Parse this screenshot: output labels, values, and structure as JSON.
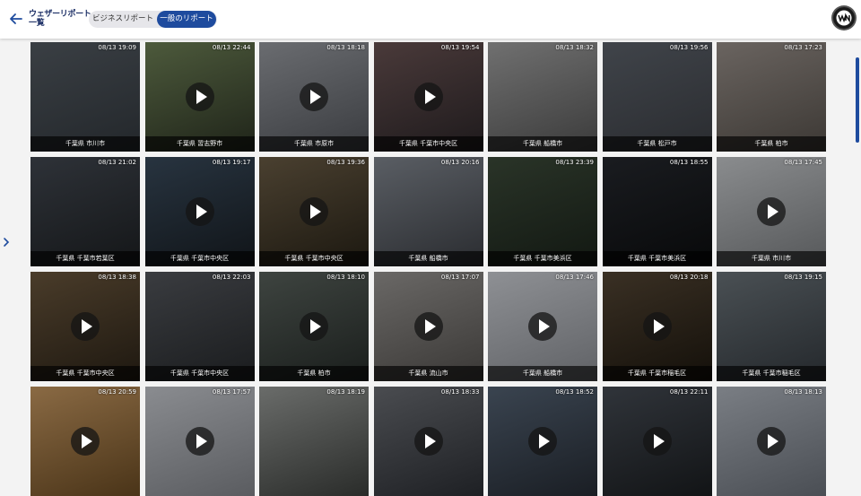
{
  "header": {
    "title_line1": "ウェザーリポート",
    "title_line2": "一覧",
    "tabs": [
      {
        "label": "ビジネスリポート",
        "active": false
      },
      {
        "label": "一般のリポート",
        "active": true
      }
    ]
  },
  "colors": {
    "accent": "#1e4b9e"
  },
  "reports": [
    {
      "time": "08/13 19:09",
      "location": "千葉県 市川市",
      "video": false,
      "bg": [
        "#3a3f44",
        "#23272b"
      ]
    },
    {
      "time": "08/13 22:44",
      "location": "千葉県 習志野市",
      "video": true,
      "bg": [
        "#4d5a3c",
        "#1f2419"
      ]
    },
    {
      "time": "08/13 18:18",
      "location": "千葉県 市原市",
      "video": true,
      "bg": [
        "#6a6c70",
        "#3a3c40"
      ]
    },
    {
      "time": "08/13 19:54",
      "location": "千葉県 千葉市中央区",
      "video": true,
      "bg": [
        "#4a3a3a",
        "#1e1a1c"
      ]
    },
    {
      "time": "08/13 18:32",
      "location": "千葉県 船橋市",
      "video": false,
      "bg": [
        "#707070",
        "#3b3b3b"
      ]
    },
    {
      "time": "08/13 19:56",
      "location": "千葉県 松戸市",
      "video": false,
      "bg": [
        "#40444a",
        "#2a2c30"
      ]
    },
    {
      "time": "08/13 17:23",
      "location": "千葉県 柏市",
      "video": false,
      "bg": [
        "#6a6460",
        "#3c3834"
      ]
    },
    {
      "time": "08/13 21:02",
      "location": "千葉県 千葉市若葉区",
      "video": false,
      "bg": [
        "#2e3238",
        "#141618"
      ]
    },
    {
      "time": "08/13 19:17",
      "location": "千葉県 千葉市中央区",
      "video": true,
      "bg": [
        "#283440",
        "#101418"
      ]
    },
    {
      "time": "08/13 19:36",
      "location": "千葉県 千葉市中央区",
      "video": true,
      "bg": [
        "#4a4030",
        "#1c1810"
      ]
    },
    {
      "time": "08/13 20:16",
      "location": "千葉県 船橋市",
      "video": false,
      "bg": [
        "#5a5e64",
        "#2a2c30"
      ]
    },
    {
      "time": "08/13 23:39",
      "location": "千葉県 千葉市美浜区",
      "video": false,
      "bg": [
        "#2a3428",
        "#121812"
      ]
    },
    {
      "time": "08/13 18:55",
      "location": "千葉県 千葉市美浜区",
      "video": false,
      "bg": [
        "#1a1c20",
        "#08090a"
      ]
    },
    {
      "time": "08/13 17:45",
      "location": "千葉県 市川市",
      "video": true,
      "bg": [
        "#8a8c8e",
        "#56585a"
      ]
    },
    {
      "time": "08/13 18:38",
      "location": "千葉県 千葉市中央区",
      "video": true,
      "bg": [
        "#4a3c2a",
        "#1e1810"
      ]
    },
    {
      "time": "08/13 22:03",
      "location": "千葉県 千葉市中央区",
      "video": false,
      "bg": [
        "#3a3c40",
        "#1a1c1e"
      ]
    },
    {
      "time": "08/13 18:10",
      "location": "千葉県 柏市",
      "video": true,
      "bg": [
        "#3e4440",
        "#1a1e1c"
      ]
    },
    {
      "time": "08/13 17:07",
      "location": "千葉県 流山市",
      "video": true,
      "bg": [
        "#6a6866",
        "#3a3836"
      ]
    },
    {
      "time": "08/13 17:46",
      "location": "千葉県 船橋市",
      "video": true,
      "bg": [
        "#8e9094",
        "#606266"
      ]
    },
    {
      "time": "08/13 20:18",
      "location": "千葉県 千葉市稲毛区",
      "video": true,
      "bg": [
        "#3a3024",
        "#14100a"
      ]
    },
    {
      "time": "08/13 19:15",
      "location": "千葉県 千葉市稲毛区",
      "video": false,
      "bg": [
        "#4a5054",
        "#24282c"
      ]
    },
    {
      "time": "08/13 20:59",
      "location": "",
      "video": true,
      "bg": [
        "#8a6a44",
        "#4a3418"
      ]
    },
    {
      "time": "08/13 17:57",
      "location": "",
      "video": true,
      "bg": [
        "#8a8c90",
        "#5a5c60"
      ]
    },
    {
      "time": "08/13 18:19",
      "location": "",
      "video": false,
      "bg": [
        "#6a6c6a",
        "#2a2c2a"
      ]
    },
    {
      "time": "08/13 18:33",
      "location": "",
      "video": true,
      "bg": [
        "#4a4c50",
        "#1e2024"
      ]
    },
    {
      "time": "08/13 18:52",
      "location": "",
      "video": true,
      "bg": [
        "#3a4450",
        "#1a1e24"
      ]
    },
    {
      "time": "08/13 22:11",
      "location": "",
      "video": true,
      "bg": [
        "#30343a",
        "#121416"
      ]
    },
    {
      "time": "08/13 18:13",
      "location": "",
      "video": true,
      "bg": [
        "#7a7e84",
        "#4a4e54"
      ]
    }
  ]
}
